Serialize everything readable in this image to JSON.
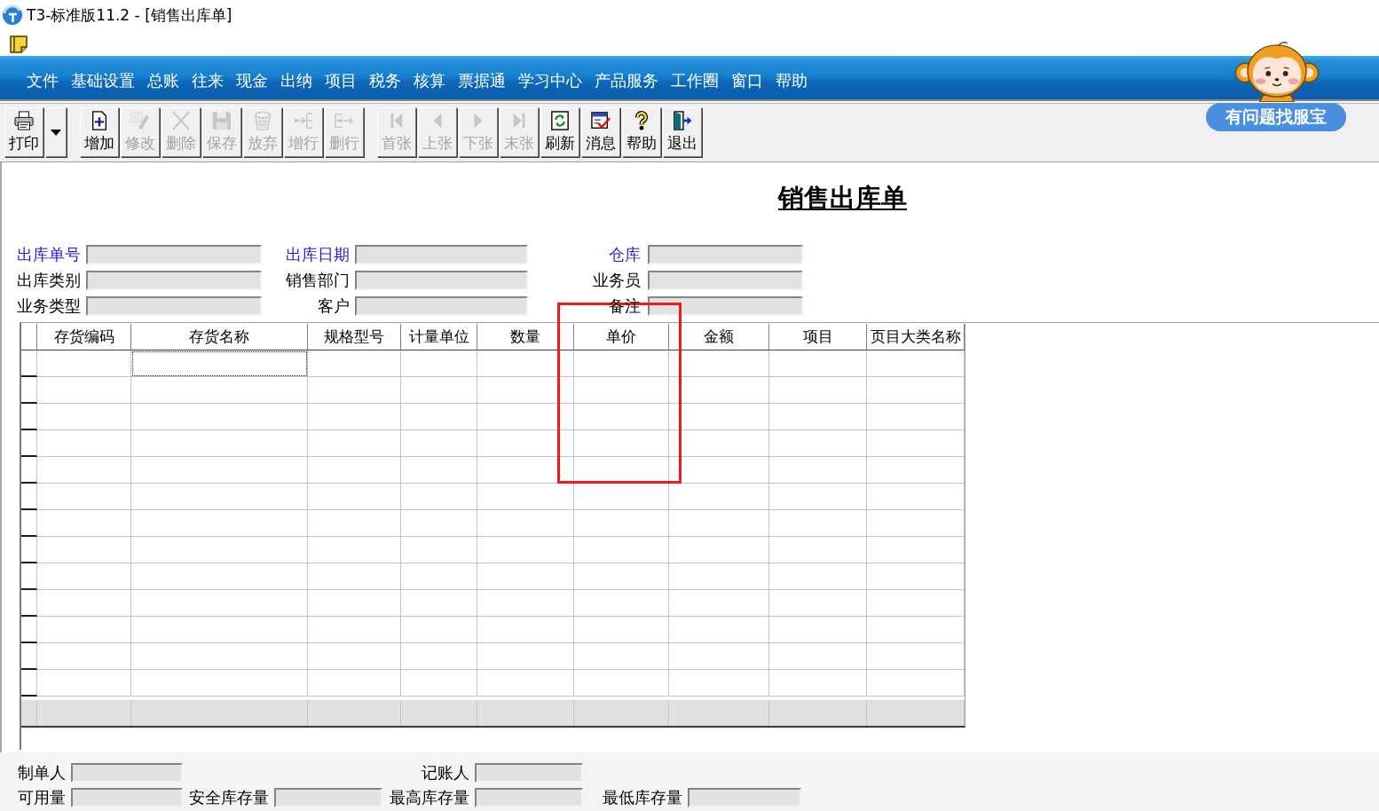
{
  "window": {
    "title": "T3-标准版11.2 - [销售出库单]"
  },
  "menu_bar": {
    "items": [
      "文件",
      "基础设置",
      "总账",
      "往来",
      "现金",
      "出纳",
      "项目",
      "税务",
      "核算",
      "票据通",
      "学习中心",
      "产品服务",
      "工作圈",
      "窗口",
      "帮助"
    ]
  },
  "assistant": {
    "label": "有问题找服宝"
  },
  "toolbar": {
    "groups": [
      {
        "buttons": [
          {
            "kind": "print",
            "label": "打印",
            "disabled": false
          },
          {
            "kind": "dropdown",
            "disabled": false
          }
        ]
      },
      {
        "buttons": [
          {
            "kind": "add",
            "label": "增加",
            "disabled": false
          },
          {
            "kind": "edit",
            "label": "修改",
            "disabled": true
          },
          {
            "kind": "delete",
            "label": "删除",
            "disabled": true
          },
          {
            "kind": "save",
            "label": "保存",
            "disabled": true
          },
          {
            "kind": "discard",
            "label": "放弃",
            "disabled": true
          },
          {
            "kind": "add-row",
            "label": "增行",
            "disabled": true
          },
          {
            "kind": "delete-row",
            "label": "删行",
            "disabled": true
          }
        ]
      },
      {
        "buttons": [
          {
            "kind": "first",
            "label": "首张",
            "disabled": true
          },
          {
            "kind": "previous",
            "label": "上张",
            "disabled": true
          },
          {
            "kind": "next",
            "label": "下张",
            "disabled": true
          },
          {
            "kind": "last",
            "label": "末张",
            "disabled": true
          },
          {
            "kind": "refresh",
            "label": "刷新",
            "disabled": false
          },
          {
            "kind": "message",
            "label": "消息",
            "disabled": false
          },
          {
            "kind": "help",
            "label": "帮助",
            "disabled": false
          },
          {
            "kind": "exit",
            "label": "退出",
            "disabled": false
          }
        ]
      }
    ]
  },
  "document": {
    "title": "销售出库单",
    "header_fields": [
      {
        "label": "出库单号",
        "required": true
      },
      {
        "label": "出库日期",
        "required": true
      },
      {
        "label": "仓库",
        "required": true
      },
      {
        "label": "出库类别",
        "required": false
      },
      {
        "label": "销售部门",
        "required": false
      },
      {
        "label": "业务员",
        "required": false
      },
      {
        "label": "业务类型",
        "required": false
      },
      {
        "label": "客户",
        "required": false
      },
      {
        "label": "备注",
        "required": false
      }
    ],
    "table": {
      "columns": [
        {
          "label": "存货编码",
          "focused": false
        },
        {
          "label": "存货名称",
          "focused": true
        },
        {
          "label": "规格型号",
          "focused": false
        },
        {
          "label": "计量单位",
          "focused": false
        },
        {
          "label": "数量",
          "focused": false
        },
        {
          "label": "单价",
          "focused": false
        },
        {
          "label": "金额",
          "focused": false
        },
        {
          "label": "项目",
          "focused": false
        },
        {
          "label": "页目大类名称",
          "focused": false
        }
      ]
    },
    "footer_rows": [
      {
        "fields": [
          {
            "label": "制单人"
          },
          {
            "label": "记账人"
          }
        ]
      },
      {
        "fields": [
          {
            "label": "可用量"
          },
          {
            "label": "安全库存量"
          },
          {
            "label": "最高库存量"
          },
          {
            "label": "最低库存量"
          }
        ]
      }
    ]
  },
  "annotation": {
    "kind": "rectangle"
  }
}
